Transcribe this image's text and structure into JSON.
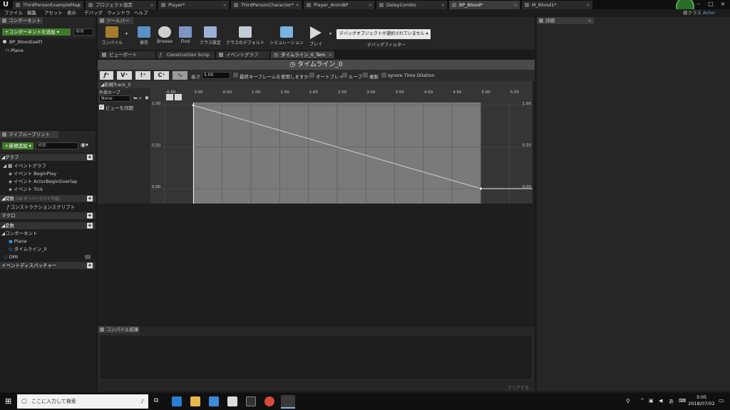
{
  "tabs": [
    {
      "label": "ThirdPersonExampleMap"
    },
    {
      "label": "プロジェクト設定"
    },
    {
      "label": "Player*"
    },
    {
      "label": "ThirdPersonCharacter*"
    },
    {
      "label": "Player_AnimBP"
    },
    {
      "label": "DelayCombo"
    },
    {
      "label": "BP_Blood*"
    },
    {
      "label": "M_Blood1*"
    }
  ],
  "parent_class": "親クラス",
  "parent_class_value": "Actor",
  "menu": [
    "ファイル",
    "編集",
    "アセット",
    "表示",
    "デバッグ",
    "ウィンドウ",
    "ヘルプ"
  ],
  "components_panel": {
    "title": "コンポーネント",
    "add_button": "コンポーネントを追加",
    "search_placeholder": "検索",
    "root": "BP_Blood(self)",
    "child": "Plane"
  },
  "toolbar": {
    "title": "ツールバー",
    "compile": "コンパイル",
    "save": "保存",
    "browse": "Browse",
    "find": "Find",
    "class_settings": "クラス設定",
    "class_defaults": "クラスのデフォルト",
    "simulation": "シミュレーション",
    "play": "プレイ",
    "debug_select": "デバッグオブジェクトが選択されていません",
    "debug_filter": "デバッグフィルター"
  },
  "editor_tabs": [
    "ビューポート",
    "Construction Scrip",
    "イベントグラフ",
    "タイムライン_0_Tem"
  ],
  "timeline": {
    "title": "タイムライン_0",
    "length_label": "長さ",
    "length_value": "5.00",
    "use_last_keyframe": "最終キーフレームを使用しますか？",
    "autoplay": "オートプレイ",
    "loop": "ループ",
    "replicate": "複製",
    "ignore_time_dilation": "Ignore Time Dilation",
    "track_name": "新規Track_0",
    "external_curve": "外部カーブ",
    "curve_value": "None",
    "sync_view": "ビューを同期"
  },
  "my_blueprint": {
    "title": "マイブループリント",
    "add_new": "新規追加",
    "search_placeholder": "検索",
    "graphs": "グラフ",
    "event_graph": "イベントグラフ",
    "events": [
      "イベント BeginPlay",
      "イベント ActorBeginOverlap",
      "イベント Tick"
    ],
    "functions": "関数",
    "functions_note": "(18 オーバーライド可能)",
    "construction_script": "コンストラクションスクリプト",
    "macros": "マクロ",
    "variables": "変数",
    "components": "コンポーネント",
    "component_items": [
      "Plane",
      "タイムライン_0"
    ],
    "dmi": "DMI",
    "dispatchers": "イベントディスパッチャー"
  },
  "details_panel": {
    "title": "詳細"
  },
  "compile_panel": {
    "title": "コンパイル結果",
    "clear": "クリアする"
  },
  "taskbar": {
    "search": "ここに入力して検索",
    "time": "3:05",
    "date": "2018/07/02"
  },
  "chart_data": {
    "type": "line",
    "x_ticks": [
      "-0.50",
      "0.00",
      "0.50",
      "1.00",
      "1.50",
      "2.00",
      "2.50",
      "3.00",
      "3.50",
      "4.00",
      "4.50",
      "5.00",
      "5.50"
    ],
    "y_ticks": [
      "1.00",
      "0.50",
      "0.00"
    ],
    "x": [
      0.0,
      5.0
    ],
    "y": [
      1.0,
      0.0
    ],
    "xlim": [
      -0.75,
      5.9
    ],
    "ylim": [
      -0.15,
      1.0
    ],
    "timeline_length": 5.0
  }
}
